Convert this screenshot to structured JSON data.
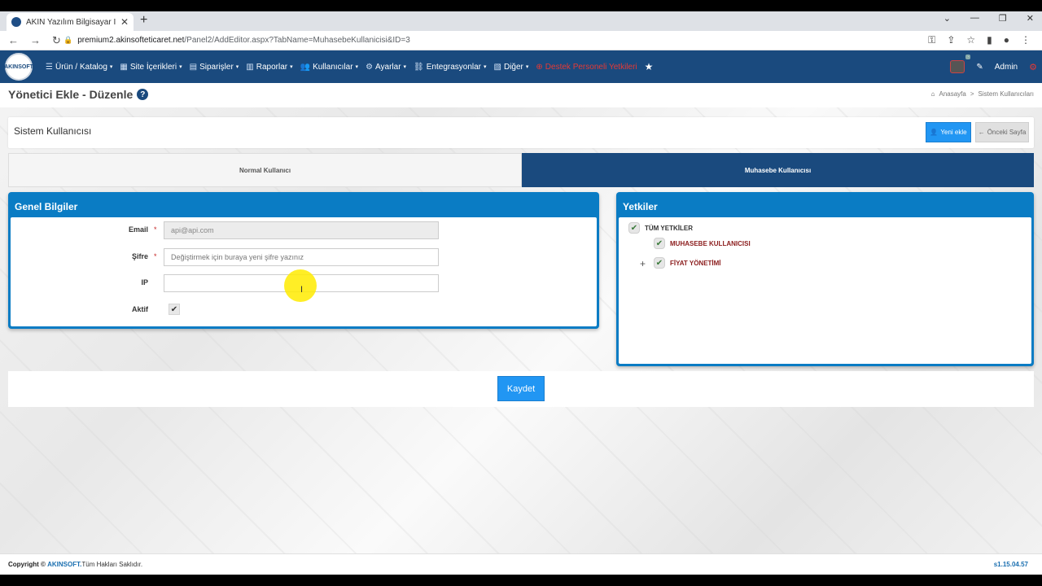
{
  "browser": {
    "tab_title": "AKIN Yazılım Bilgisayar İth. İhr. S...",
    "tab_close": "✕",
    "new_tab": "+",
    "url_domain": "premium2.akinsofteticaret.net",
    "url_path": "/Panel2/AddEditor.aspx?TabName=MuhasebeKullanicisi&ID=3"
  },
  "nav": {
    "logo_text": "AKINSOFT",
    "items": [
      {
        "label": "Ürün / Katalog",
        "icon": "bars-icon"
      },
      {
        "label": "Site İçerikleri",
        "icon": "sitemap-icon"
      },
      {
        "label": "Siparişler",
        "icon": "cart-icon"
      },
      {
        "label": "Raporlar",
        "icon": "chart-icon"
      },
      {
        "label": "Kullanıcılar",
        "icon": "users-icon"
      },
      {
        "label": "Ayarlar",
        "icon": "gear-icon"
      },
      {
        "label": "Entegrasyonlar",
        "icon": "network-icon"
      },
      {
        "label": "Diğer",
        "icon": "stack-icon"
      }
    ],
    "alert_item": "Destek Personeli Yetkileri",
    "admin_label": "Admin"
  },
  "page": {
    "title": "Yönetici Ekle - Düzenle",
    "breadcrumb_home": "Anasayfa",
    "breadcrumb_sep": ">",
    "breadcrumb_current": "Sistem Kullanıcıları",
    "section_title": "Sistem Kullanıcısı",
    "btn_new": "Yeni ekle",
    "btn_prev": "Önceki Sayfa",
    "tabs": [
      "Normal Kullanıcı",
      "Muhasebe Kullanıcısı"
    ]
  },
  "general": {
    "title": "Genel Bilgiler",
    "email_label": "Email",
    "email_value": "api@api.com",
    "password_label": "Şifre",
    "password_placeholder": "Değiştirmek için buraya yeni şifre yazınız",
    "ip_label": "IP",
    "ip_value": "",
    "active_label": "Aktif",
    "required_mark": "*"
  },
  "permissions": {
    "title": "Yetkiler",
    "root": "TÜM YETKİLER",
    "children": [
      "MUHASEBE KULLANICISI",
      "FİYAT YÖNETİMİ"
    ]
  },
  "actions": {
    "save": "Kaydet"
  },
  "footer": {
    "copyright_prefix": "Copyright ©",
    "brand": "AKINSOFT.",
    "rights": "Tüm Hakları Saklıdır.",
    "version": "s1.15.04.57"
  },
  "colors": {
    "header": "#1a4a7e",
    "panel": "#0a7cc4",
    "primary_button": "#2196f3",
    "alert": "#e53935"
  }
}
